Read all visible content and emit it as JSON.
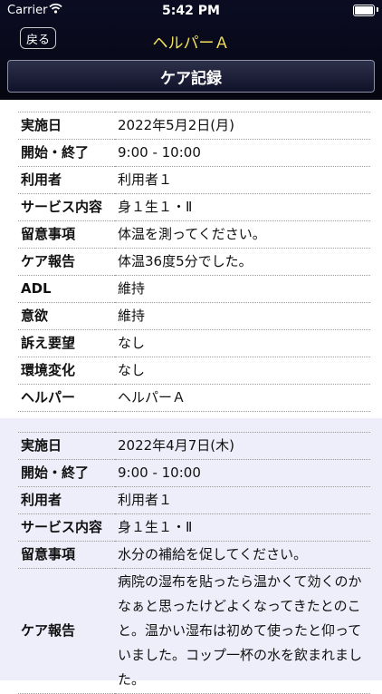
{
  "status_bar": {
    "carrier": "Carrier",
    "time": "5:42 PM"
  },
  "nav": {
    "back_label": "戻る",
    "title": "ヘルパーＡ"
  },
  "section_title": "ケア記録",
  "records": [
    {
      "rows": [
        {
          "label": "実施日",
          "value": "2022年5月2日(月)"
        },
        {
          "label": "開始・終了",
          "value": "9:00 - 10:00"
        },
        {
          "label": "利用者",
          "value": "利用者１"
        },
        {
          "label": "サービス内容",
          "value": "身１生１・Ⅱ"
        },
        {
          "label": "留意事項",
          "value": "体温を測ってください。"
        },
        {
          "label": "ケア報告",
          "value": "体温36度5分でした。"
        },
        {
          "label": "ADL",
          "value": "維持"
        },
        {
          "label": "意欲",
          "value": "維持"
        },
        {
          "label": "訴え要望",
          "value": "なし"
        },
        {
          "label": "環境変化",
          "value": "なし"
        },
        {
          "label": "ヘルパー",
          "value": "ヘルパーＡ"
        }
      ]
    },
    {
      "rows": [
        {
          "label": "実施日",
          "value": "2022年4月7日(木)"
        },
        {
          "label": "開始・終了",
          "value": "9:00 - 10:00"
        },
        {
          "label": "利用者",
          "value": "利用者１"
        },
        {
          "label": "サービス内容",
          "value": "身１生１・Ⅱ"
        },
        {
          "label": "留意事項",
          "value": "水分の補給を促してください。"
        },
        {
          "label": "ケア報告",
          "value": "病院の湿布を貼ったら温かくて効くのかなぁと思ったけどよくなってきたとのこと。温かい湿布は初めて使ったと仰っていました。コップ一杯の水を飲まれました。"
        }
      ]
    }
  ]
}
